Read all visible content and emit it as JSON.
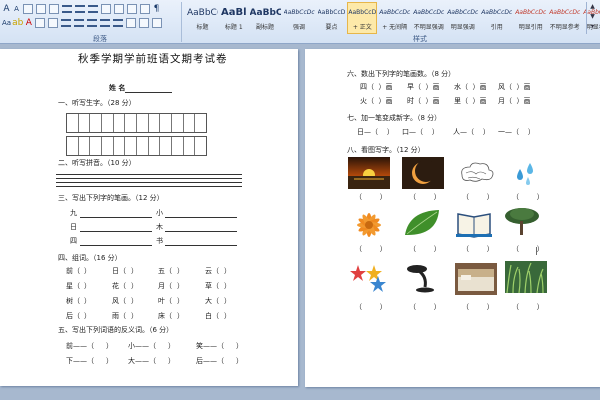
{
  "ribbon": {
    "group_labels": {
      "paragraph": "段落",
      "styles": "样式"
    },
    "styles": [
      {
        "sample": "AaBbC(",
        "name": "标题"
      },
      {
        "sample": "AaBl",
        "name": "标题 1"
      },
      {
        "sample": "AaBbC",
        "name": "副标题"
      },
      {
        "sample": "AaBbCcDc",
        "name": "强调"
      },
      {
        "sample": "AaBbCcD",
        "name": "要点"
      },
      {
        "sample": "AaBbCcD",
        "name": "+ 正文",
        "active": true
      },
      {
        "sample": "AaBbCcDc",
        "name": "+ 无间隔"
      },
      {
        "sample": "AaBbCcDc",
        "name": "不明显强调"
      },
      {
        "sample": "AaBbCcDc",
        "name": "明显强调"
      },
      {
        "sample": "AaBbCcDc",
        "name": "引用"
      },
      {
        "sample": "AaBbCcDc",
        "name": "明显引用"
      },
      {
        "sample": "AaBbCcDc",
        "name": "不明显参考"
      },
      {
        "sample": "AaBbCcDc",
        "name": "明显参考"
      }
    ]
  },
  "left_page": {
    "title": "秋季学期学前班语文期考试卷",
    "name_label": "姓 名",
    "s1": "一、听写生字。（28 分）",
    "s2": "二、听写拼音。（10 分）",
    "s3": "三、写出下列字的笔画。（12 分）",
    "s3_chars": [
      "九",
      "小",
      "日",
      "木",
      "四",
      "书"
    ],
    "s4": "四、组词。（16 分）",
    "s4_rows": [
      [
        "前（",
        "）",
        "日（",
        "）",
        "五（",
        "）",
        "云（",
        "）"
      ],
      [
        "星（",
        "）",
        "花（",
        "）",
        "月（",
        "）",
        "草（",
        "）"
      ],
      [
        "树（",
        "）",
        "风（",
        "）",
        "叶（",
        "）",
        "大（",
        "）"
      ],
      [
        "后（",
        "）",
        "雨（",
        "）",
        "床（",
        "）",
        "白（",
        "）"
      ]
    ],
    "s5": "五、写出下列词语的反义词。（6 分）",
    "s5_rows": [
      [
        "前——（",
        "）",
        "小——（",
        "）",
        "笑——（",
        "）"
      ],
      [
        "下——（",
        "）",
        "大——（",
        "）",
        "后——（",
        "）"
      ]
    ]
  },
  "right_page": {
    "s6": "六、数出下列字的笔画数。（8 分）",
    "s6_rows": [
      [
        "四（  ）画",
        "早（  ）画",
        "水（  ）画",
        "风（  ）画"
      ],
      [
        "火（  ）画",
        "时（  ）画",
        "里（  ）画",
        "月（  ）画"
      ]
    ],
    "s7": "七、加一笔变成新字。（8 分）",
    "s7_row": [
      "日—（    ）",
      "口—（    ）",
      "人—（    ）",
      "一—（    ）"
    ],
    "s8": "八、看图写字。（12 分）",
    "paren": "（        ）"
  },
  "colors": {
    "ribbon_active": "#fde9a9",
    "workspace": "#a7b8cf"
  }
}
